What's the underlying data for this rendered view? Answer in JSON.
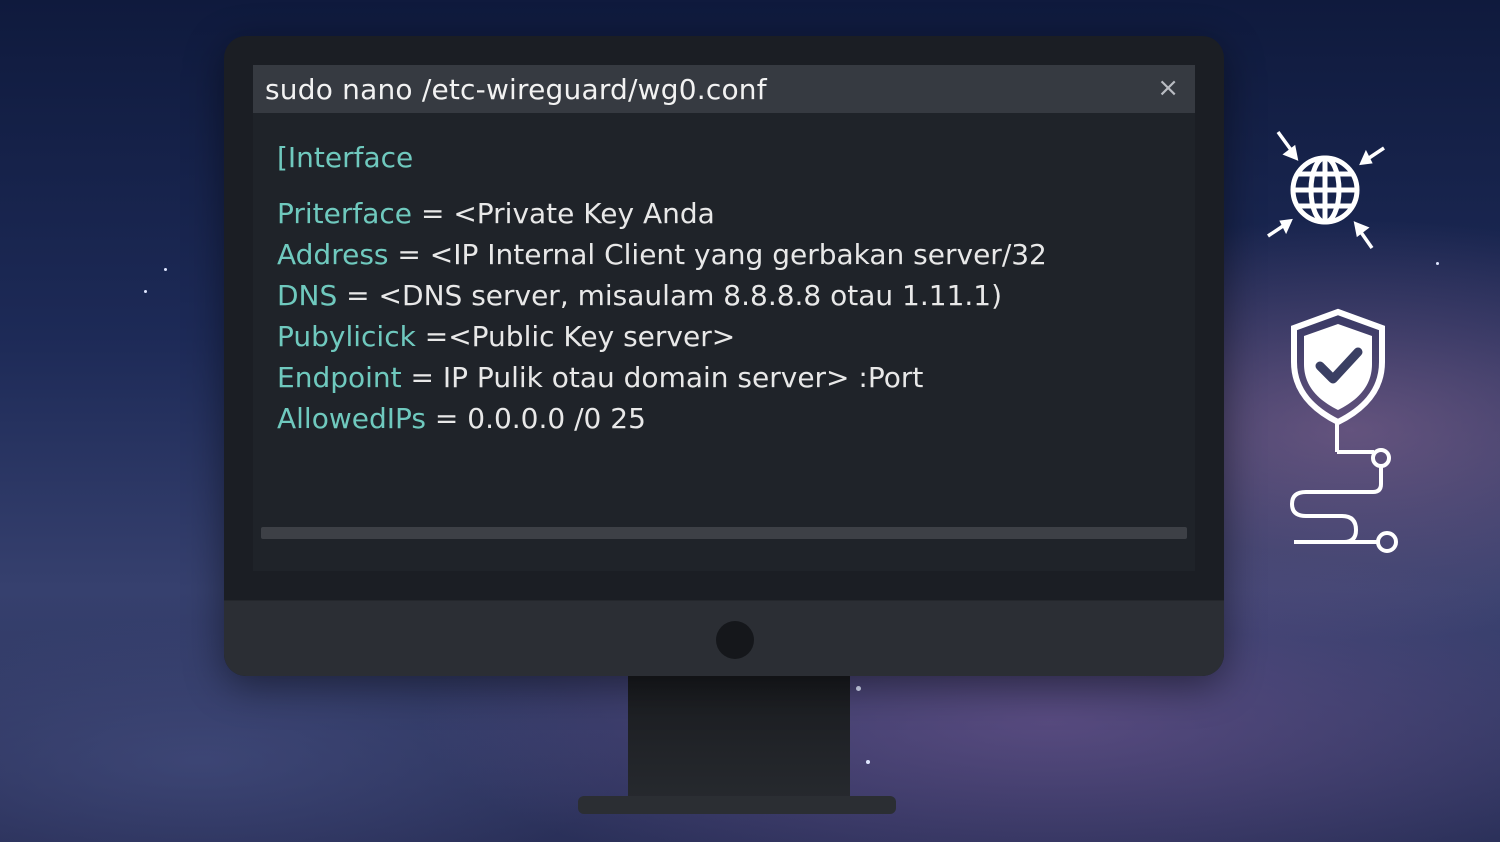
{
  "window": {
    "title": "sudo nano /etc-wireguard/wg0.conf",
    "close_icon": "×"
  },
  "config": {
    "section": "[Interface",
    "lines": [
      {
        "key": "Priterface",
        "sep": " = ",
        "value": "<Private Key Anda"
      },
      {
        "key": "Address",
        "sep": " = ",
        "value": "<IP Internal Client yang gerbakan server/32"
      },
      {
        "key": "DNS",
        "sep": " = ",
        "value": "<DNS server, misaulam 8.8.8.8 otau 1.11.1)"
      },
      {
        "key": "Pubylicick",
        "sep": " =",
        "value": "<Public Key server>"
      },
      {
        "key": "Endpoint",
        "sep": " = ",
        "value": "IP Pulik otau domain server> :Port"
      },
      {
        "key": "AllowedIPs",
        "sep": " = ",
        "value": "0.0.0.0 /0  25"
      }
    ]
  },
  "colors": {
    "key": "#6fc9be",
    "text": "#e8e8e8",
    "titlebar": "#363a41"
  },
  "icons": [
    "globe-arrows-icon",
    "shield-check-icon",
    "route-path-icon"
  ]
}
